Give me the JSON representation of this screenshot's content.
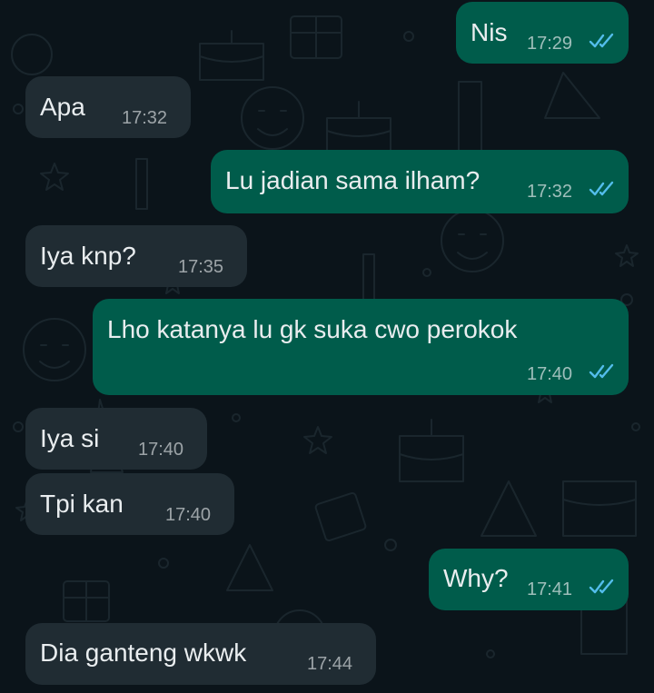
{
  "chat": {
    "messages": [
      {
        "direction": "out",
        "text": "Nis",
        "time": "17:29",
        "status": "read"
      },
      {
        "direction": "in",
        "text": "Apa",
        "time": "17:32"
      },
      {
        "direction": "out",
        "text": "Lu jadian sama ilham?",
        "time": "17:32",
        "status": "read"
      },
      {
        "direction": "in",
        "text": "Iya knp?",
        "time": "17:35"
      },
      {
        "direction": "out",
        "text": "Lho katanya lu gk suka cwo perokok",
        "time": "17:40",
        "status": "read"
      },
      {
        "direction": "in",
        "text": "Iya si",
        "time": "17:40"
      },
      {
        "direction": "in",
        "text": "Tpi kan",
        "time": "17:40"
      },
      {
        "direction": "out",
        "text": "Why?",
        "time": "17:41",
        "status": "read"
      },
      {
        "direction": "in",
        "text": "Dia ganteng wkwk",
        "time": "17:44"
      }
    ]
  },
  "colors": {
    "background": "#0b141a",
    "incoming_bubble": "#202c33",
    "outgoing_bubble": "#005c4b",
    "text": "#e9edef",
    "read_ticks": "#53bdeb"
  },
  "icons": {
    "read_receipt": "double-check-icon",
    "wallpaper": "doodle-pattern"
  }
}
